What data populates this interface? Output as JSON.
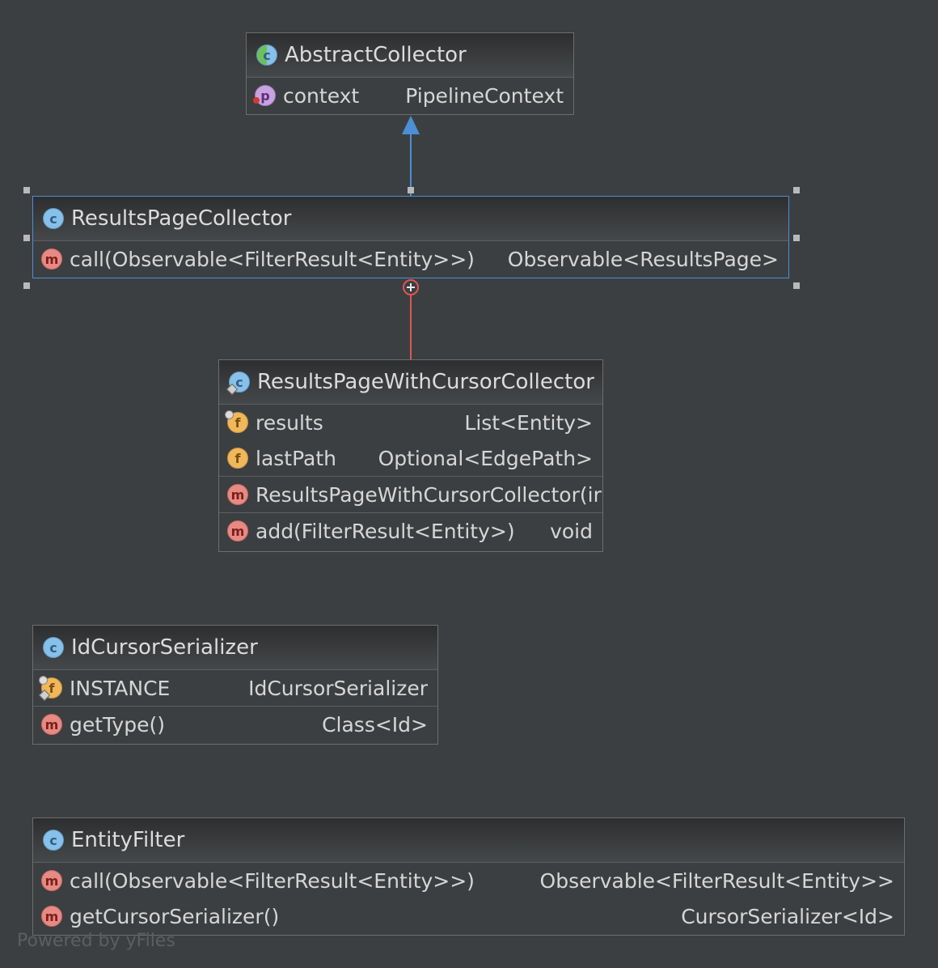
{
  "nodes": {
    "abstract_collector": {
      "title": "AbstractCollector",
      "fields": [
        {
          "name": "context",
          "type": "PipelineContext"
        }
      ]
    },
    "results_page_collector": {
      "title": "ResultsPageCollector",
      "methods": [
        {
          "name": "call(Observable<FilterResult<Entity>>)",
          "type": "Observable<ResultsPage>"
        }
      ]
    },
    "results_page_with_cursor_collector": {
      "title": "ResultsPageWithCursorCollector",
      "fields": [
        {
          "name": "results",
          "type": "List<Entity>"
        },
        {
          "name": "lastPath",
          "type": "Optional<EdgePath>"
        }
      ],
      "constructors": [
        {
          "name": "ResultsPageWithCursorCollector(ir"
        }
      ],
      "methods": [
        {
          "name": "add(FilterResult<Entity>)",
          "type": "void"
        }
      ]
    },
    "id_cursor_serializer": {
      "title": "IdCursorSerializer",
      "fields": [
        {
          "name": "INSTANCE",
          "type": "IdCursorSerializer"
        }
      ],
      "methods": [
        {
          "name": "getType()",
          "type": "Class<Id>"
        }
      ]
    },
    "entity_filter": {
      "title": "EntityFilter",
      "methods": [
        {
          "name": "call(Observable<FilterResult<Entity>>)",
          "type": "Observable<FilterResult<Entity>>"
        },
        {
          "name": "getCursorSerializer()",
          "type": "CursorSerializer<Id>"
        }
      ]
    }
  },
  "icons": {
    "class": "c",
    "method": "m",
    "field": "f",
    "property": "p"
  },
  "colors": {
    "background": "#3c3f41",
    "inheritance_edge": "#4b8fd6",
    "inner_class_edge": "#e05555",
    "selection": "#4b8fd6"
  },
  "footer": "Powered by yFiles"
}
